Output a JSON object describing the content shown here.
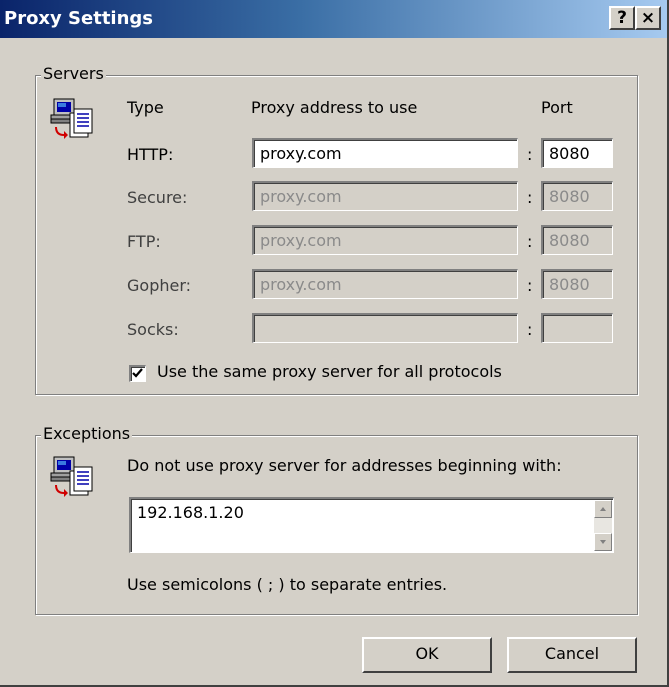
{
  "window": {
    "title": "Proxy Settings",
    "help_button": "?",
    "close_button": "×"
  },
  "servers": {
    "legend": "Servers",
    "icon": "network-computers-icon",
    "headers": {
      "type": "Type",
      "address": "Proxy address to use",
      "port": "Port"
    },
    "rows": [
      {
        "label": "HTTP:",
        "address": "proxy.com",
        "port": "8080",
        "enabled": true
      },
      {
        "label": "Secure:",
        "address": "proxy.com",
        "port": "8080",
        "enabled": false
      },
      {
        "label": "FTP:",
        "address": "proxy.com",
        "port": "8080",
        "enabled": false
      },
      {
        "label": "Gopher:",
        "address": "proxy.com",
        "port": "8080",
        "enabled": false
      },
      {
        "label": "Socks:",
        "address": "",
        "port": "",
        "enabled": false
      }
    ],
    "separator": ":",
    "same_proxy_label": "Use the same proxy server for all protocols",
    "same_proxy_checked": true
  },
  "exceptions": {
    "legend": "Exceptions",
    "icon": "network-computers-icon",
    "instruction": "Do not use proxy server for addresses beginning with:",
    "value": "192.168.1.20",
    "hint": "Use semicolons ( ; ) to separate entries."
  },
  "buttons": {
    "ok": "OK",
    "cancel": "Cancel"
  }
}
